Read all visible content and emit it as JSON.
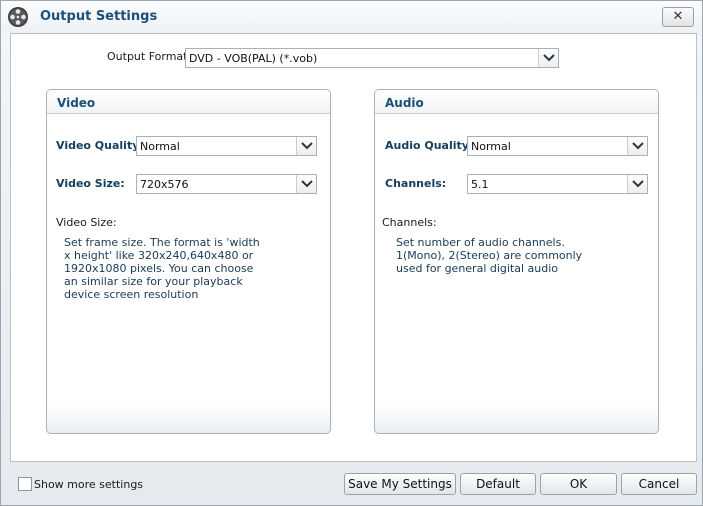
{
  "window": {
    "title": "Output Settings",
    "close_label": "✕"
  },
  "output_format": {
    "label": "Output Format:",
    "value": "DVD - VOB(PAL) (*.vob)"
  },
  "video": {
    "header": "Video",
    "quality_label": "Video Quality:",
    "quality_value": "Normal",
    "size_label": "Video Size:",
    "size_value": "720x576",
    "desc_title": "Video Size:",
    "desc_text": "Set frame size. The format is 'width x height' like 320x240,640x480 or 1920x1080 pixels. You can choose an similar size for your playback device screen resolution"
  },
  "audio": {
    "header": "Audio",
    "quality_label": "Audio Quality:",
    "quality_value": "Normal",
    "channels_label": "Channels:",
    "channels_value": "5.1",
    "desc_title": "Channels:",
    "desc_text": "Set number of audio channels. 1(Mono), 2(Stereo) are commonly used for general digital audio"
  },
  "footer": {
    "show_more_label": "Show more settings",
    "save_label": "Save My Settings",
    "default_label": "Default",
    "ok_label": "OK",
    "cancel_label": "Cancel"
  },
  "colors": {
    "title": "#1d4f7a",
    "field_label": "#153e60"
  }
}
